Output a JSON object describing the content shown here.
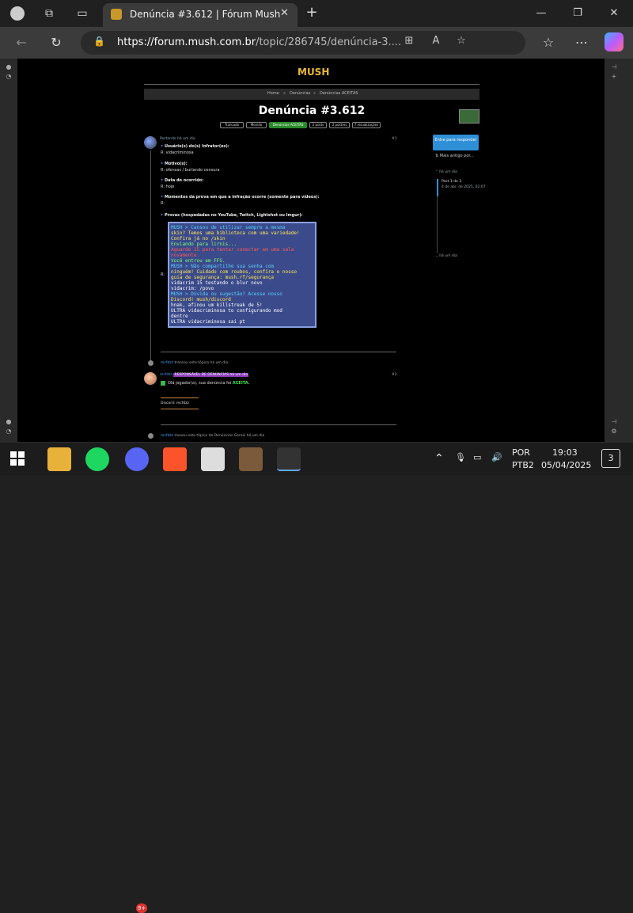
{
  "browser": {
    "tab_title": "Denúncia #3.612 | Fórum Mush",
    "tab_close": "✕",
    "new_tab": "+",
    "url_host": "https://forum.mush.com.br",
    "url_path": "/topic/286745/denúncia-3....",
    "window": {
      "minimize": "—",
      "maximize": "❐",
      "close": "✕"
    }
  },
  "forum": {
    "logo": "MUSH",
    "breadcrumb": [
      "Home",
      "»",
      "Denúncias",
      "»",
      "Denúncias ACEITAS"
    ],
    "title": "Denúncia #3.612",
    "tags": [
      {
        "label": "Trancado"
      },
      {
        "label": "Movido"
      },
      {
        "label": "Denúncias ACEITAS",
        "green": true
      },
      {
        "label": "2 posts"
      },
      {
        "label": "2 postres"
      },
      {
        "label": "7 visualizações"
      }
    ],
    "reply_button": "Entre para responder",
    "older_link": "Mais antigo por...",
    "timeline": {
      "top_time": "há um dia",
      "post_counter": "Post 1 de 3",
      "post_date": "4 de abr. de 2025, 02:07",
      "bottom_time": "há um dia"
    },
    "post1": {
      "author_line": "Postando há um dia",
      "index": "#1",
      "q1": "Usuário(s) do(s) Infrator(es):",
      "a1": "R: vidacriminosa",
      "q2": "Motivo(s):",
      "a2": "R: ofensas / burlando censura",
      "q3": "Data do ocorrido:",
      "a3": "R: hoje",
      "q4": "Momentos da prova em que a infração ocorre (somente para vídeos):",
      "a4": "R:",
      "q5": "Provas (hospedadas no YouTube, Twitch, Lightshot ou Imgur):",
      "a5": "R:"
    },
    "chat_lines": [
      {
        "text": "MUSH > Cansou de utilizar sempre a mesma",
        "color": "#5ad0ff"
      },
      {
        "text": "skin? Temos uma biblioteca com uma variedade!",
        "color": "#ffe85a"
      },
      {
        "text": "Confira já no /skin",
        "color": "#ffe85a"
      },
      {
        "text": "Enviando para lirnis...",
        "color": "#7aff7a"
      },
      {
        "text": "Aguarde 15 para tentar conectar em uma sala",
        "color": "#ff5a5a"
      },
      {
        "text": "novamente.",
        "color": "#ff5a5a"
      },
      {
        "text": "Você entrou em FFS.",
        "color": "#7aff7a"
      },
      {
        "text": "MUSH > Não compartilhe sua senha com",
        "color": "#5ad0ff"
      },
      {
        "text": "ninguém! Cuidado com roubos, confira o nosso",
        "color": "#ffe85a"
      },
      {
        "text": "guia de segurança: mush.rf/segurança",
        "color": "#ffe85a"
      },
      {
        "text": "  vidacrim 15 testando o blur novo",
        "color": "#ffffff"
      },
      {
        "text": "  vidacrim: /povo",
        "color": "#ffffff"
      },
      {
        "text": "MUSH > Dúvida ou sugestão? Acesse nosso",
        "color": "#5ad0ff"
      },
      {
        "text": "Discord! mush/discord",
        "color": "#ffe85a"
      },
      {
        "text": "hnak, afinou um killstreak de 5!",
        "color": "#ffffff"
      },
      {
        "text": "ULTRA vidacriminosa to configurando mod",
        "color": "#ffffff"
      },
      {
        "text": "dentre",
        "color": "#ffffff"
      },
      {
        "text": "ULTRA vidacriminosa sai pt",
        "color": "#ffffff"
      }
    ],
    "event1": "trancou este tópico há um dia",
    "post2": {
      "author_line": "RESPONSÁVEL DE DENÚNCIAS  há um dia",
      "index": "#2",
      "body_prefix": "Olá jogador(a), sua denúncia foi",
      "status": "ACEITA.",
      "signature": "Discord: mcfdzz"
    },
    "event2": "moveu este tópico de Denúncias Gerais há um dia"
  },
  "taskbar": {
    "lang": "POR",
    "layout": "PTB2",
    "time": "19:03",
    "date": "05/04/2025",
    "notif_count": "3",
    "badge": "9+"
  }
}
